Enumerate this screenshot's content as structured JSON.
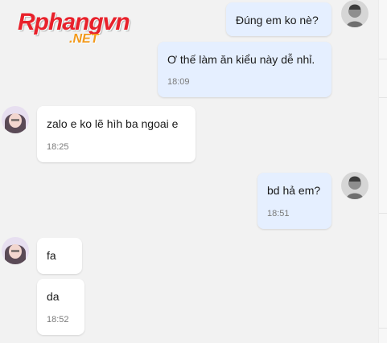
{
  "logo": {
    "main": "Rphangvn",
    "sub": ".NET"
  },
  "colors": {
    "outgoing_bubble": "#e5efff",
    "incoming_bubble": "#ffffff",
    "background": "#f2f2f2",
    "logo_red": "#e8212b",
    "logo_orange": "#f39a1c"
  },
  "messages": [
    {
      "direction": "outgoing",
      "text": "Đúng em ko nè?",
      "time": ""
    },
    {
      "direction": "outgoing",
      "text": "Ơ thế làm ăn kiểu này dễ nhỉ.",
      "time": "18:09"
    },
    {
      "direction": "incoming",
      "text": "zalo e ko lẽ hìh ba ngoai e",
      "time": "18:25"
    },
    {
      "direction": "outgoing",
      "text": "bd hả em?",
      "time": "18:51"
    },
    {
      "direction": "incoming",
      "text": "fa",
      "time": ""
    },
    {
      "direction": "incoming",
      "text": "da",
      "time": "18:52"
    }
  ]
}
